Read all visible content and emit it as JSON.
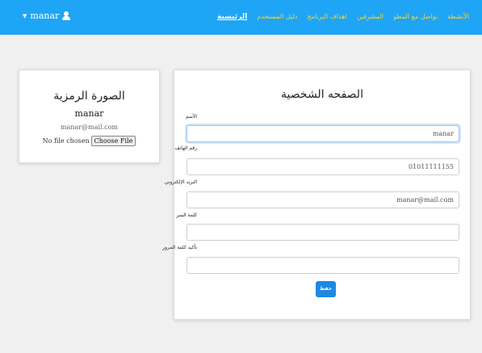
{
  "navbar": {
    "user_name": "manar",
    "links": [
      {
        "label": "الرئيسية",
        "active": true
      },
      {
        "label": "دليل المستخدم",
        "active": false
      },
      {
        "label": "اهداف البرنامج",
        "active": false
      },
      {
        "label": "المشرفين",
        "active": false
      },
      {
        "label": "تواصل مع المطو",
        "active": false
      },
      {
        "label": "الأنشطة",
        "active": false
      }
    ],
    "colors": {
      "background": "#1fa5f5",
      "link": "#f3d53a",
      "active_link": "#ffffff"
    }
  },
  "avatar_card": {
    "title": "الصورة الرمزية",
    "name": "manar",
    "email": "manar@mail.com",
    "file_status": "No file chosen",
    "choose_file_label": "Choose File"
  },
  "profile_form": {
    "title": "الصفحه الشخصية",
    "fields": [
      {
        "label": "الأسم",
        "value": "manar"
      },
      {
        "label": "رقم الهاتف",
        "value": "01011111155"
      },
      {
        "label": "البريد الإلكتروني",
        "value": "manar@mail.com"
      },
      {
        "label": "كلمة السر",
        "value": ""
      },
      {
        "label": "تأكيد كلمة المرور",
        "value": ""
      }
    ],
    "save_label": "حفظ",
    "save_color": "#1e88e5"
  }
}
